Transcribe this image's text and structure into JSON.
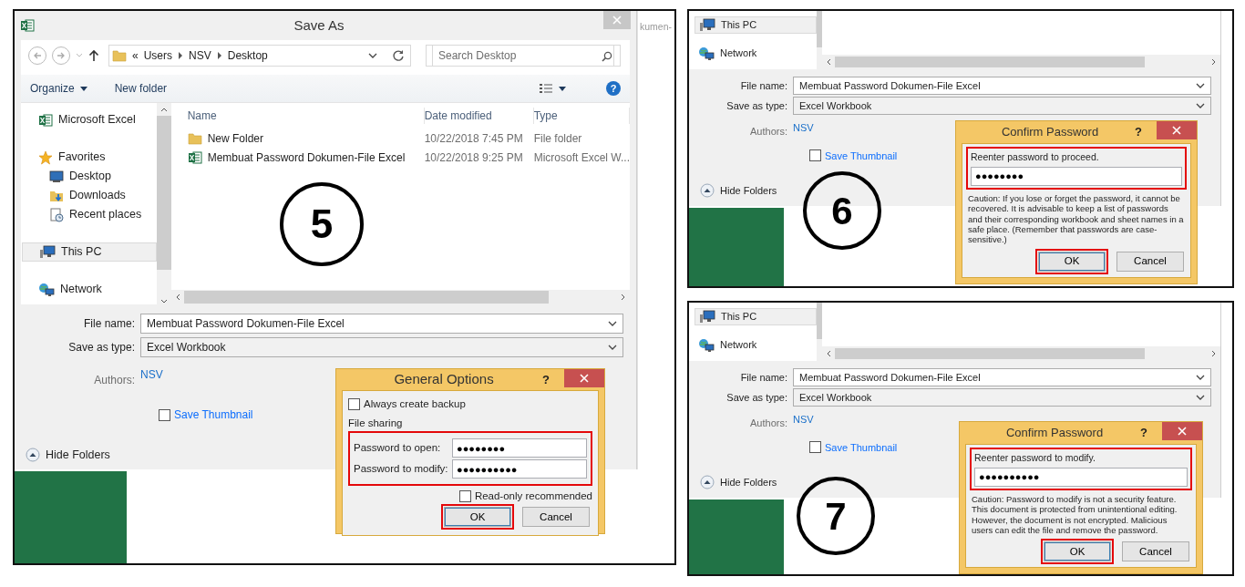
{
  "step_5": {
    "step": "5",
    "background_text": "kumen-",
    "window": {
      "title": "Save As"
    },
    "address": {
      "overflow": "«",
      "path": [
        "Users",
        "NSV",
        "Desktop"
      ]
    },
    "search": {
      "placeholder": "Search Desktop"
    },
    "commands": [
      "Organize",
      "New folder"
    ],
    "help": "?",
    "sidebar": [
      {
        "label": "Microsoft Excel",
        "kind": "excel",
        "selected": false
      },
      {
        "label": "Favorites",
        "kind": "favorites",
        "selected": false,
        "children": [
          {
            "label": "Desktop",
            "kind": "desktop",
            "selected": false
          },
          {
            "label": "Downloads",
            "kind": "downloads",
            "selected": false
          },
          {
            "label": "Recent places",
            "kind": "recent",
            "selected": false
          }
        ]
      },
      {
        "label": "This PC",
        "kind": "pc",
        "selected": true
      },
      {
        "label": "Network",
        "kind": "network",
        "selected": false
      }
    ],
    "columns": [
      "Name",
      "Date modified",
      "Type"
    ],
    "files": [
      {
        "kind": "folder",
        "name": "New Folder",
        "date": "10/22/2018 7:45 PM",
        "type": "File folder"
      },
      {
        "kind": "excel",
        "name": "Membuat Password Dokumen-File Excel",
        "date": "10/22/2018 9:25 PM",
        "type": "Microsoft Excel W..."
      }
    ],
    "form": {
      "file_name_label": "File name:",
      "file_name": "Membuat Password Dokumen-File Excel",
      "type_label": "Save as type:",
      "type": "Excel Workbook",
      "authors_label": "Authors:",
      "authors": "NSV",
      "thumbnail": {
        "label": "Save Thumbnail",
        "checked": false
      },
      "hide_folders": "Hide Folders"
    },
    "dialog": {
      "title": "General Options",
      "help": "?",
      "backup": {
        "label": "Always create backup",
        "checked": false
      },
      "group": "File sharing",
      "fields_highlighted": true,
      "fields": [
        {
          "label": "Password to open:",
          "value": "●●●●●●●●"
        },
        {
          "label": "Password to modify:",
          "value": "●●●●●●●●●●"
        }
      ],
      "readonly": {
        "label": "Read-only recommended",
        "checked": false
      },
      "buttons": [
        {
          "label": "OK",
          "highlighted": true
        },
        {
          "label": "Cancel",
          "highlighted": false
        }
      ]
    }
  },
  "confirm_steps": [
    {
      "step": "6",
      "sidebar": [
        {
          "label": "This PC",
          "kind": "pc",
          "selected": true
        },
        {
          "label": "Network",
          "kind": "network",
          "selected": false
        }
      ],
      "form": {
        "file_name_label": "File name:",
        "file_name": "Membuat Password Dokumen-File Excel",
        "type_label": "Save as type:",
        "type": "Excel Workbook",
        "authors_label": "Authors:",
        "authors": "NSV",
        "thumbnail": {
          "label": "Save Thumbnail",
          "checked": false
        },
        "hide_folders": "Hide Folders"
      },
      "dialog": {
        "title": "Confirm Password",
        "help": "?",
        "prompt": "Reenter password to proceed.",
        "value": "●●●●●●●●",
        "prompt_highlighted": true,
        "caution": "Caution: If you lose or forget the password, it cannot be recovered. It is advisable to keep a list of passwords and their corresponding workbook and sheet names in a safe place.  (Remember that passwords are case-sensitive.)",
        "buttons": [
          {
            "label": "OK",
            "highlighted": true
          },
          {
            "label": "Cancel",
            "highlighted": false
          }
        ]
      }
    },
    {
      "step": "7",
      "sidebar": [
        {
          "label": "This PC",
          "kind": "pc",
          "selected": true
        },
        {
          "label": "Network",
          "kind": "network",
          "selected": false
        }
      ],
      "form": {
        "file_name_label": "File name:",
        "file_name": "Membuat Password Dokumen-File Excel",
        "type_label": "Save as type:",
        "type": "Excel Workbook",
        "authors_label": "Authors:",
        "authors": "NSV",
        "thumbnail": {
          "label": "Save Thumbnail",
          "checked": false
        },
        "hide_folders": "Hide Folders"
      },
      "dialog": {
        "title": "Confirm Password",
        "help": "?",
        "prompt": "Reenter password to modify.",
        "value": "●●●●●●●●●●",
        "prompt_highlighted": true,
        "caution": "Caution: Password to modify is not a security feature. This document is protected from unintentional editing. However, the document is not encrypted. Malicious users can edit the file and remove the password.",
        "buttons": [
          {
            "label": "OK",
            "highlighted": true
          },
          {
            "label": "Cancel",
            "highlighted": false
          }
        ]
      }
    }
  ]
}
